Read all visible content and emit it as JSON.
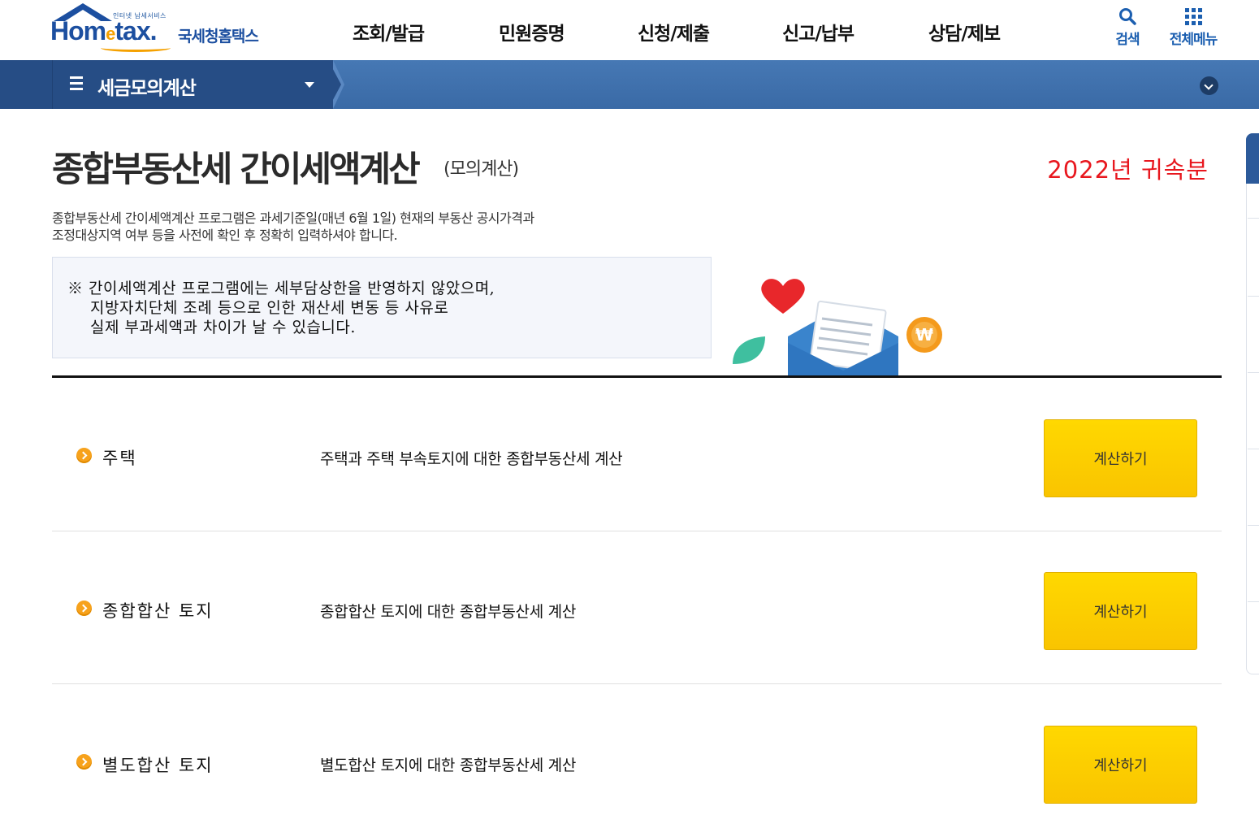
{
  "header": {
    "logo_tagline": "인터넷 납세서비스",
    "logo_brand_home": "Hom",
    "logo_brand_e": "e",
    "logo_brand_tax": "tax.",
    "logo_korean": "국세청홈택스",
    "nav": [
      "조회/발급",
      "민원증명",
      "신청/제출",
      "신고/납부",
      "상담/제보"
    ],
    "search_label": "검색",
    "all_menu_label": "전체메뉴"
  },
  "navbar": {
    "title": "세금모의계산"
  },
  "page": {
    "title": "종합부동산세 간이세액계산",
    "subtitle": "(모의계산)",
    "year": "2022년 귀속분",
    "desc_line1": "종합부동산세 간이세액계산 프로그램은 과세기준일(매년 6월 1일) 현재의 부동산 공시가격과",
    "desc_line2": "조정대상지역 여부 등을 사전에 확인 후 정확히 입력하셔야 합니다.",
    "notice_line1": "※ 간이세액계산 프로그램에는 세부담상한을 반영하지 않았으며,",
    "notice_line2": "지방자치단체 조례 등으로 인한 재산세 변동 등 사유로",
    "notice_line3": "실제 부과세액과 차이가 날 수 있습니다."
  },
  "rows": [
    {
      "label": "주택",
      "desc": "주택과 주택 부속토지에 대한 종합부동산세 계산",
      "button": "계산하기"
    },
    {
      "label": "종합합산 토지",
      "desc": "종합합산 토지에 대한 종합부동산세 계산",
      "button": "계산하기"
    },
    {
      "label": "별도합산 토지",
      "desc": "별도합산 토지에 대한 종합부동산세 계산",
      "button": "계산하기"
    }
  ],
  "colors": {
    "brand_blue": "#1c4fa0",
    "nav_dark": "#264d85",
    "year_red": "#e8171e",
    "button_yellow": "#ffd800",
    "bullet_orange": "#f7a21c"
  },
  "icons": [
    "search-icon",
    "grid-menu-icon",
    "hamburger-icon",
    "chevron-down-icon",
    "arrow-bullet-icon"
  ]
}
